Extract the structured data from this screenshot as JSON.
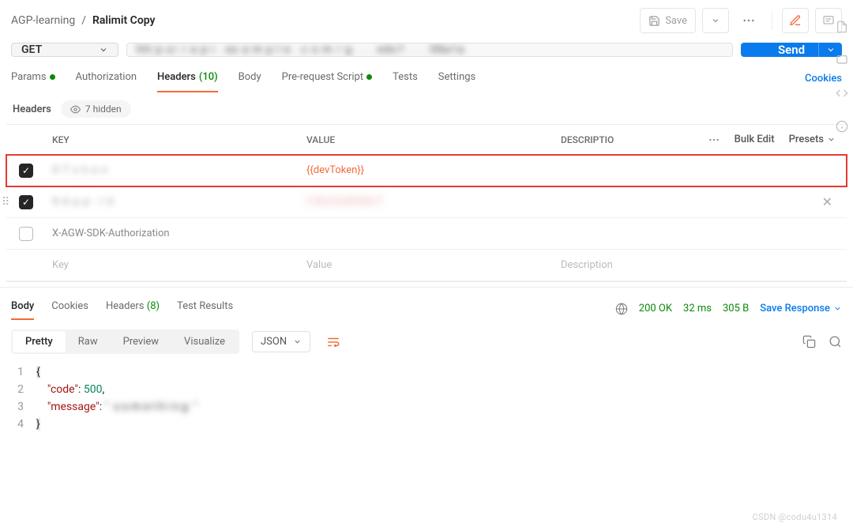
{
  "breadcrumb": {
    "workspace": "AGP-learning",
    "sep": "/",
    "request_name": "Ralimit Copy"
  },
  "toolbar": {
    "save_label": "Save"
  },
  "request": {
    "method": "GET",
    "url_blurred": "htt p s/ / a p i . ex a m p l e . c o m / g . . .  edc7 . . .   08a1a",
    "send_label": "Send"
  },
  "req_tabs": {
    "params": "Params",
    "authorization": "Authorization",
    "headers": "Headers",
    "headers_count": "(10)",
    "body": "Body",
    "prerequest": "Pre-request Script",
    "tests": "Tests",
    "settings": "Settings",
    "cookies": "Cookies"
  },
  "headers_section": {
    "label": "Headers",
    "hidden_pill": "7 hidden",
    "col_key": "KEY",
    "col_value": "VALUE",
    "col_description": "DESCRIPTIO",
    "bulk_edit": "Bulk Edit",
    "presets": "Presets",
    "rows": [
      {
        "checked": true,
        "key_blurred": "X-T o k e n",
        "value": "{{devToken}}",
        "highlight": true
      },
      {
        "checked": true,
        "key_blurred": "X-A p p - I d",
        "value_blurred": "1 0 2 3 4 5 6 7",
        "closable": true,
        "drag": true
      },
      {
        "checked": false,
        "key": "X-AGW-SDK-Authorization",
        "value": ""
      }
    ],
    "placeholder_key": "Key",
    "placeholder_value": "Value",
    "placeholder_desc": "Description"
  },
  "response_tabs": {
    "body": "Body",
    "cookies": "Cookies",
    "headers": "Headers",
    "headers_count": "(8)",
    "test_results": "Test Results"
  },
  "response_status": {
    "code": "200 OK",
    "time": "32 ms",
    "size": "305 B",
    "save_response": "Save Response"
  },
  "body_view": {
    "pretty": "Pretty",
    "raw": "Raw",
    "preview": "Preview",
    "visualize": "Visualize",
    "format": "JSON"
  },
  "response_body": {
    "lines": [
      {
        "n": "1",
        "text_open": "{"
      },
      {
        "n": "2",
        "indent": "    ",
        "key": "\"code\"",
        "sep": ": ",
        "num": "500",
        "tail": ","
      },
      {
        "n": "3",
        "indent": "    ",
        "key": "\"message\"",
        "sep": ": ",
        "str_blur": "\"  s o m e t h i n g  \""
      },
      {
        "n": "4",
        "text_close": "}"
      }
    ]
  },
  "watermark": "CSDN @codu4u1314"
}
